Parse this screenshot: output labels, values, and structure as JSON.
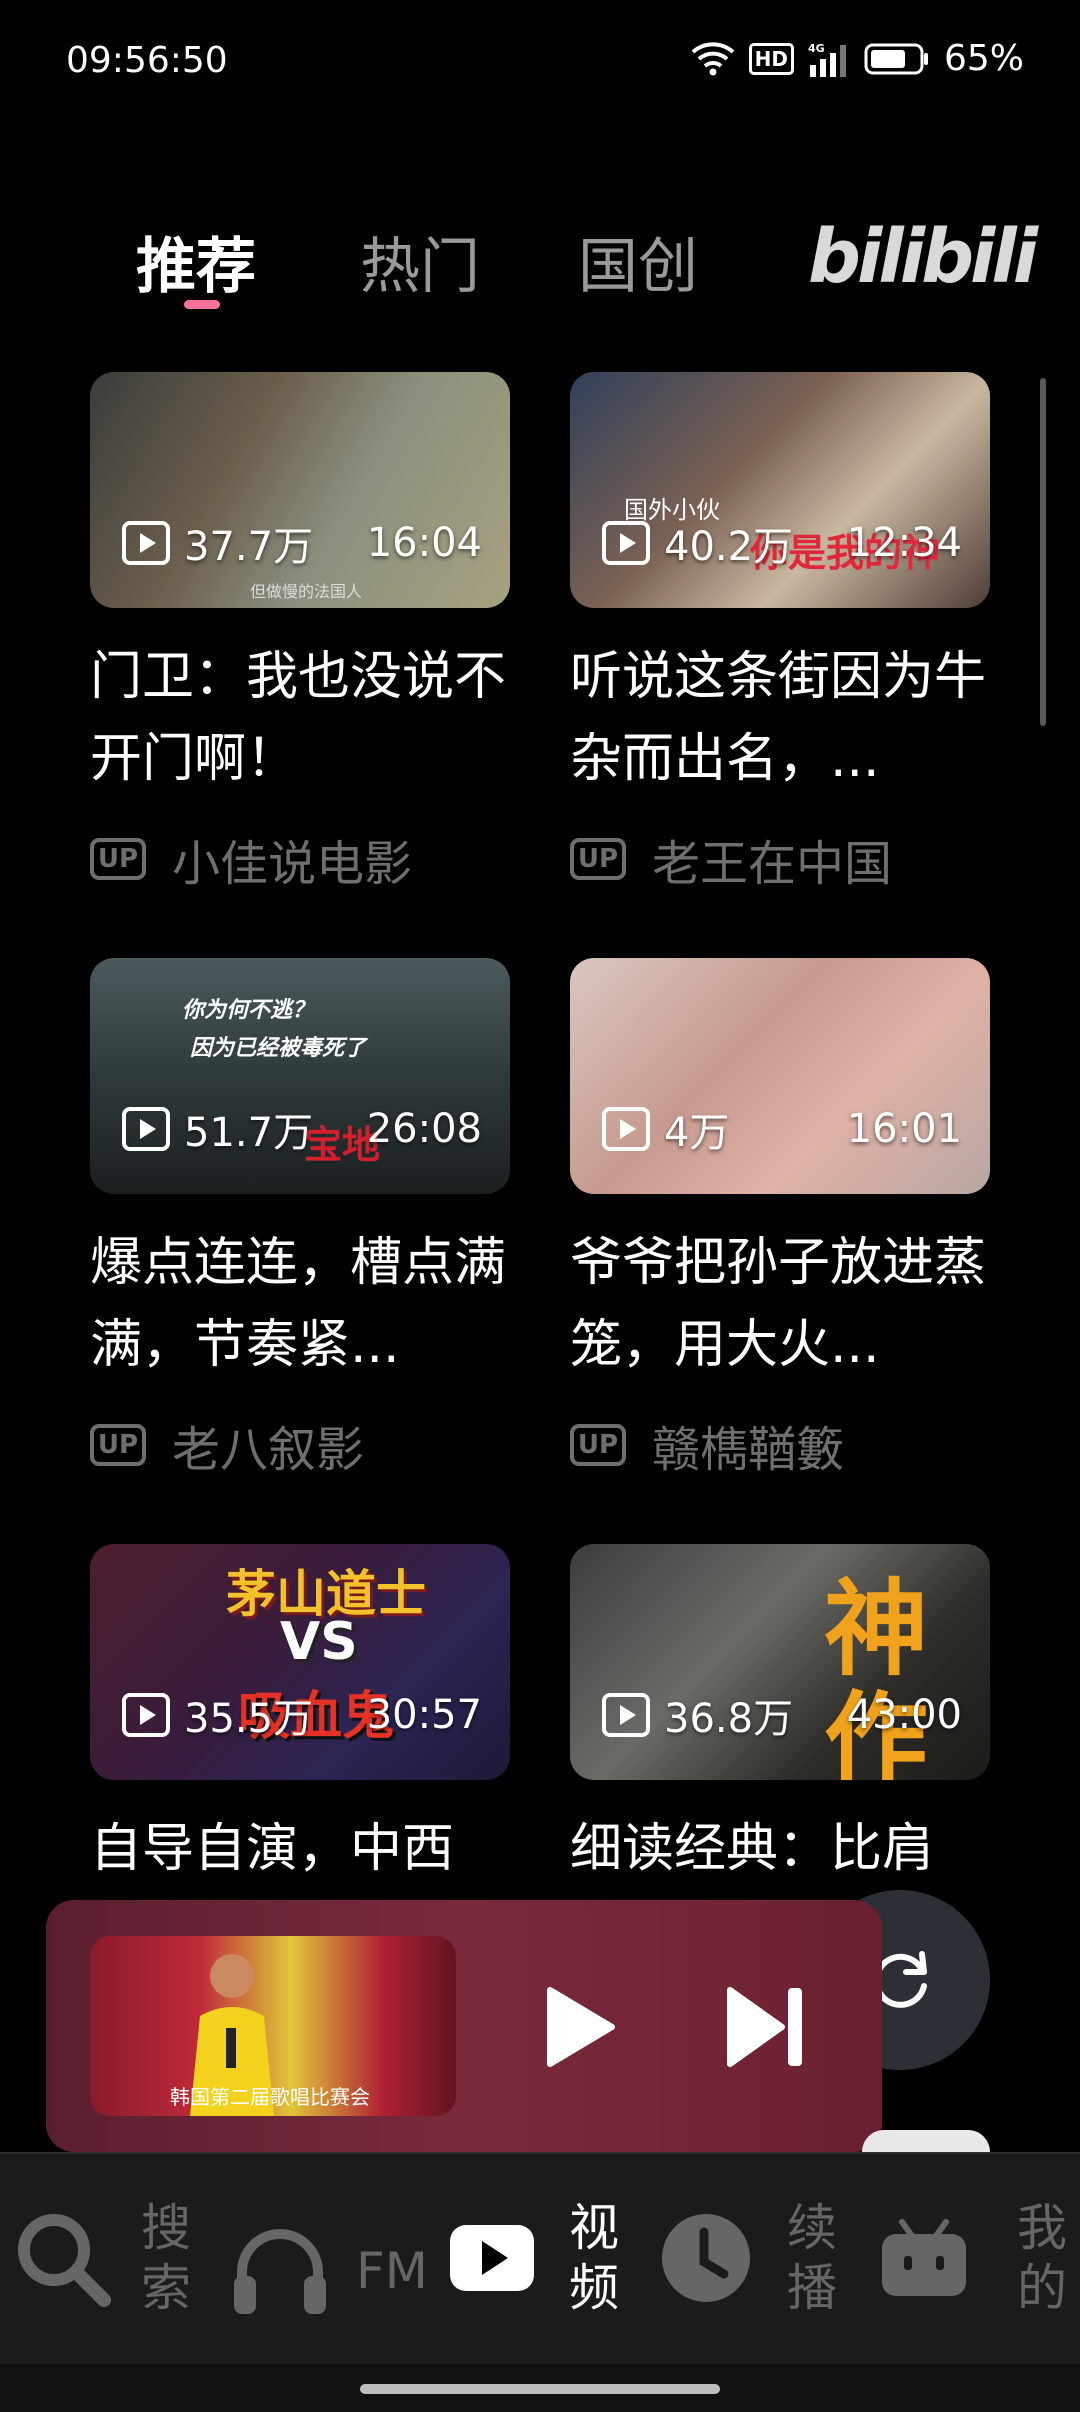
{
  "status_bar": {
    "time": "09:56:50",
    "hd_label": "HD",
    "network_label": "4G",
    "battery": "65%"
  },
  "tabs": [
    {
      "label": "推荐",
      "active": true
    },
    {
      "label": "热门",
      "active": false
    },
    {
      "label": "国创",
      "active": false
    }
  ],
  "brand": "bilibili",
  "accent_color": "#fb7299",
  "videos": [
    {
      "views": "37.7万",
      "duration": "16:04",
      "title": "门卫：我也没说不开门啊！",
      "uploader": "小佳说电影",
      "thumb_caption": "但做慢的法国人"
    },
    {
      "views": "40.2万",
      "duration": "12:34",
      "title": "听说这条街因为牛杂而出名，...",
      "uploader": "老王在中国",
      "thumb_caption": "国外小伙",
      "thumb_caption2": "你是我的神"
    },
    {
      "views": "51.7万",
      "duration": "26:08",
      "title": "爆点连连，槽点满满，节奏紧...",
      "uploader": "老八叙影",
      "thumb_caption": "你为何不逃？",
      "thumb_caption2": "因为已经被毒死了",
      "thumb_caption3": "宝地"
    },
    {
      "views": "4万",
      "duration": "16:01",
      "title": "爷爷把孙子放进蒸笼，用大火...",
      "uploader": "赣檇鞧籔"
    },
    {
      "views": "35.5万",
      "duration": "30:57",
      "title": "自导自演，中西",
      "uploader": "",
      "thumb_caption": "茅山道士",
      "thumb_caption2": "VS",
      "thumb_caption3": "吸血鬼"
    },
    {
      "views": "36.8万",
      "duration": "43:00",
      "title": "细读经典：比肩",
      "uploader": "",
      "thumb_caption": "神",
      "thumb_caption2": "作"
    }
  ],
  "up_badge": "UP",
  "mini_player": {
    "caption": "韩国第二届歌唱比赛会"
  },
  "bottom_nav": [
    {
      "label": "搜索",
      "icon": "search-icon",
      "active": false
    },
    {
      "label": "FM",
      "icon": "headphones-icon",
      "active": false
    },
    {
      "label": "视频",
      "icon": "video-play-icon",
      "active": true
    },
    {
      "label": "续播",
      "icon": "clock-icon",
      "active": false
    },
    {
      "label": "我的",
      "icon": "tv-mascot-icon",
      "active": false
    }
  ]
}
